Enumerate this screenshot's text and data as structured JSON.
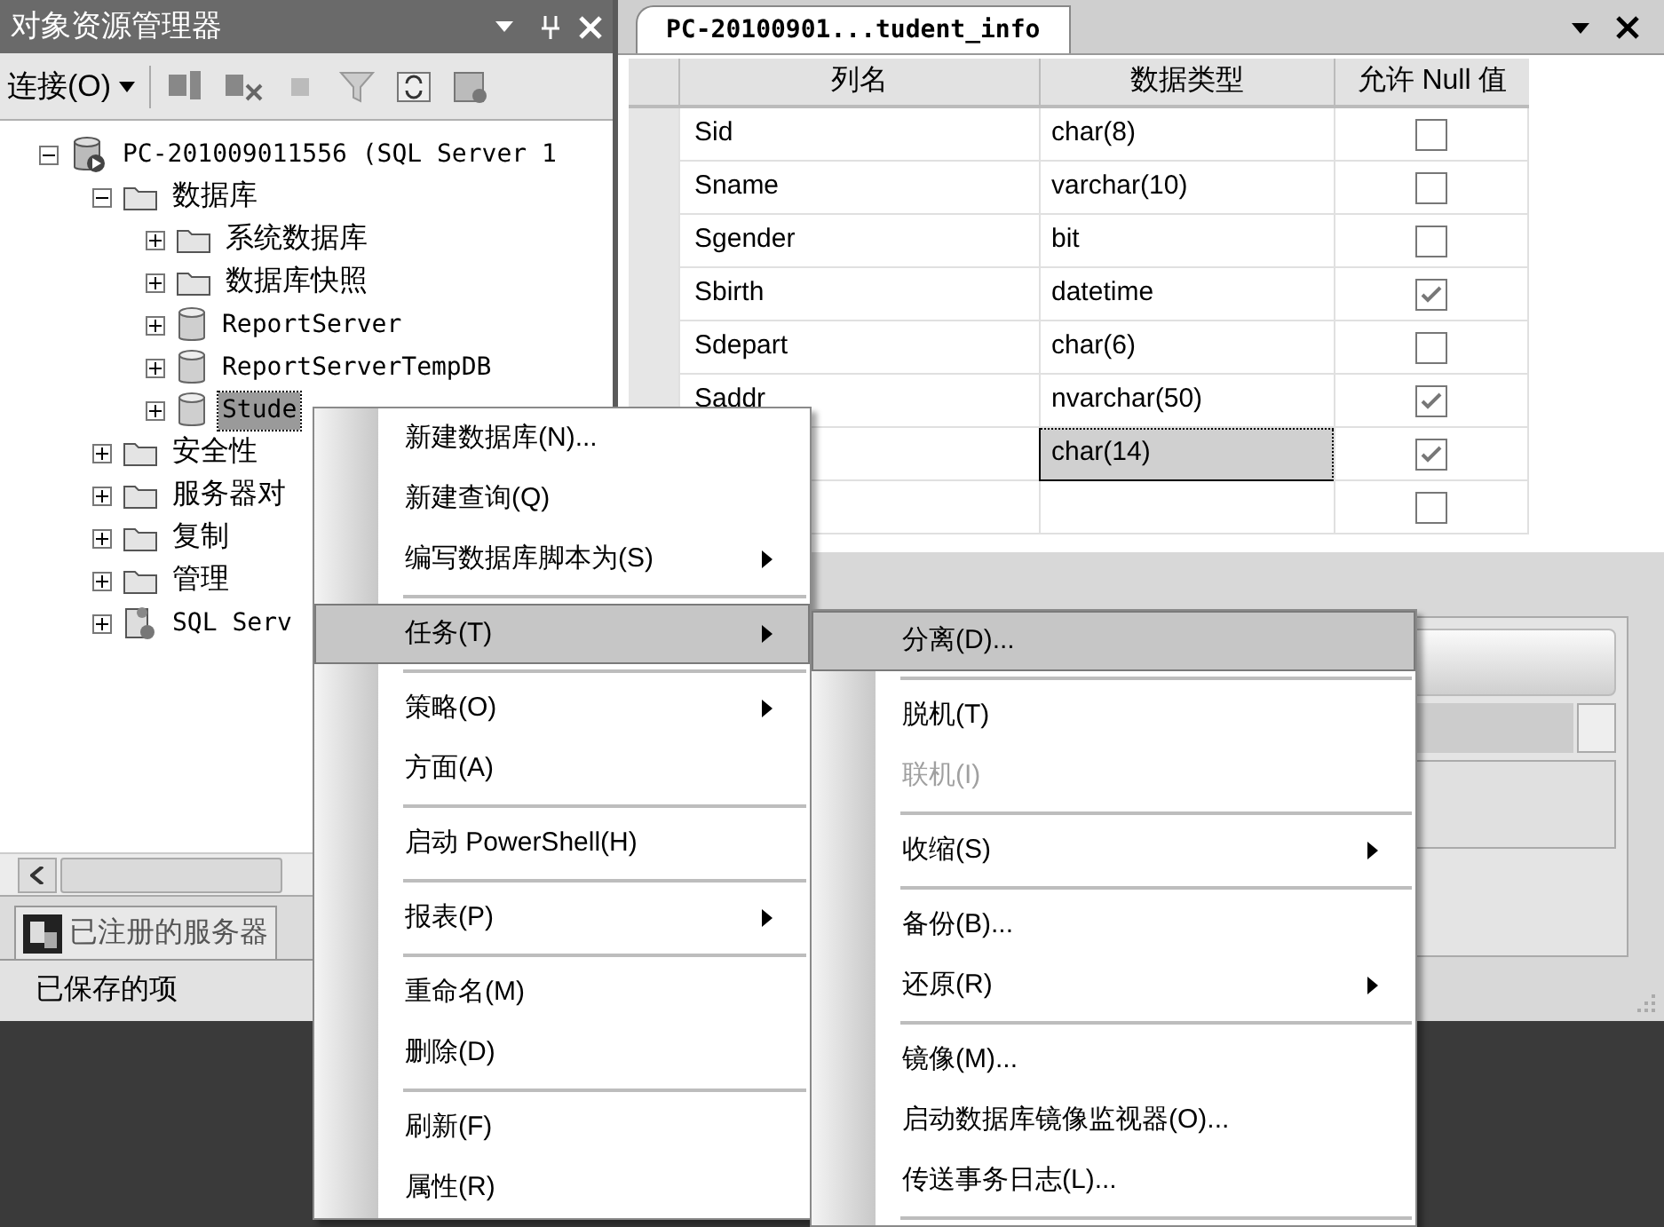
{
  "object_explorer": {
    "title": "对象资源管理器",
    "connect": "连接(O)",
    "tree": [
      {
        "label": "PC-201009011556 (SQL Server 1",
        "kind": "server",
        "expanded": true,
        "selected": false,
        "children": [
          {
            "label": "数据库",
            "kind": "folder",
            "expanded": true,
            "selected": false,
            "children": [
              {
                "label": "系统数据库",
                "kind": "folder",
                "expanded": false,
                "selected": false
              },
              {
                "label": "数据库快照",
                "kind": "folder",
                "expanded": false,
                "selected": false
              },
              {
                "label": "ReportServer",
                "kind": "database",
                "expanded": false,
                "selected": false
              },
              {
                "label": "ReportServerTempDB",
                "kind": "database",
                "expanded": false,
                "selected": false
              },
              {
                "label": "Stude",
                "kind": "database",
                "expanded": false,
                "selected": true
              }
            ]
          },
          {
            "label": "安全性",
            "kind": "folder",
            "expanded": false,
            "selected": false
          },
          {
            "label": "服务器对",
            "kind": "folder",
            "expanded": false,
            "selected": false
          },
          {
            "label": "复制",
            "kind": "folder",
            "expanded": false,
            "selected": false
          },
          {
            "label": "管理",
            "kind": "folder",
            "expanded": false,
            "selected": false
          },
          {
            "label": "SQL Serv",
            "kind": "agent",
            "expanded": false,
            "selected": false
          }
        ]
      }
    ],
    "registered_servers_tab": "已注册的服务器",
    "saved_items": "已保存的项"
  },
  "document": {
    "tab": "PC-20100901...tudent_info",
    "columns": [
      "列名",
      "数据类型",
      "允许 Null 值"
    ],
    "rows": [
      {
        "name": "Sid",
        "type": "char(8)",
        "allow_null": false,
        "selected": false
      },
      {
        "name": "Sname",
        "type": "varchar(10)",
        "allow_null": false,
        "selected": false
      },
      {
        "name": "Sgender",
        "type": "bit",
        "allow_null": false,
        "selected": false
      },
      {
        "name": "Sbirth",
        "type": "datetime",
        "allow_null": true,
        "selected": false
      },
      {
        "name": "Sdepart",
        "type": "char(6)",
        "allow_null": false,
        "selected": false
      },
      {
        "name": "Saddr",
        "type": "nvarchar(50)",
        "allow_null": true,
        "selected": false
      },
      {
        "type": "char(14)",
        "allow_null": true,
        "selected": true
      },
      {
        "allow_null": false,
        "selected": false
      }
    ]
  },
  "context_menu": [
    {
      "kind": "item",
      "label": "新建数据库(N)...",
      "submenu": false,
      "selected": false
    },
    {
      "kind": "item",
      "label": "新建查询(Q)",
      "submenu": false,
      "selected": false
    },
    {
      "kind": "item",
      "label": "编写数据库脚本为(S)",
      "submenu": true,
      "selected": false
    },
    {
      "kind": "separator"
    },
    {
      "kind": "item",
      "label": "任务(T)",
      "submenu": true,
      "selected": true
    },
    {
      "kind": "separator"
    },
    {
      "kind": "item",
      "label": "策略(O)",
      "submenu": true,
      "selected": false
    },
    {
      "kind": "item",
      "label": "方面(A)",
      "submenu": false,
      "selected": false
    },
    {
      "kind": "separator"
    },
    {
      "kind": "item",
      "label": "启动 PowerShell(H)",
      "submenu": false,
      "selected": false
    },
    {
      "kind": "separator"
    },
    {
      "kind": "item",
      "label": "报表(P)",
      "submenu": true,
      "selected": false
    },
    {
      "kind": "separator"
    },
    {
      "kind": "item",
      "label": "重命名(M)",
      "submenu": false,
      "selected": false
    },
    {
      "kind": "item",
      "label": "删除(D)",
      "submenu": false,
      "selected": false
    },
    {
      "kind": "separator"
    },
    {
      "kind": "item",
      "label": "刷新(F)",
      "submenu": false,
      "selected": false
    },
    {
      "kind": "item",
      "label": "属性(R)",
      "submenu": false,
      "selected": false
    }
  ],
  "task_submenu": [
    {
      "kind": "item",
      "label": "分离(D)...",
      "submenu": false,
      "selected": true,
      "disabled": false
    },
    {
      "kind": "separator"
    },
    {
      "kind": "item",
      "label": "脱机(T)",
      "submenu": false,
      "selected": false,
      "disabled": false
    },
    {
      "kind": "item",
      "label": "联机(I)",
      "submenu": false,
      "selected": false,
      "disabled": true
    },
    {
      "kind": "separator"
    },
    {
      "kind": "item",
      "label": "收缩(S)",
      "submenu": true,
      "selected": false,
      "disabled": false
    },
    {
      "kind": "separator"
    },
    {
      "kind": "item",
      "label": "备份(B)...",
      "submenu": false,
      "selected": false,
      "disabled": false
    },
    {
      "kind": "item",
      "label": "还原(R)",
      "submenu": true,
      "selected": false,
      "disabled": false
    },
    {
      "kind": "separator"
    },
    {
      "kind": "item",
      "label": "镜像(M)...",
      "submenu": false,
      "selected": false,
      "disabled": false
    },
    {
      "kind": "item",
      "label": "启动数据库镜像监视器(O)...",
      "submenu": false,
      "selected": false,
      "disabled": false
    },
    {
      "kind": "item",
      "label": "传送事务日志(L)...",
      "submenu": false,
      "selected": false,
      "disabled": false
    },
    {
      "kind": "separator"
    }
  ]
}
